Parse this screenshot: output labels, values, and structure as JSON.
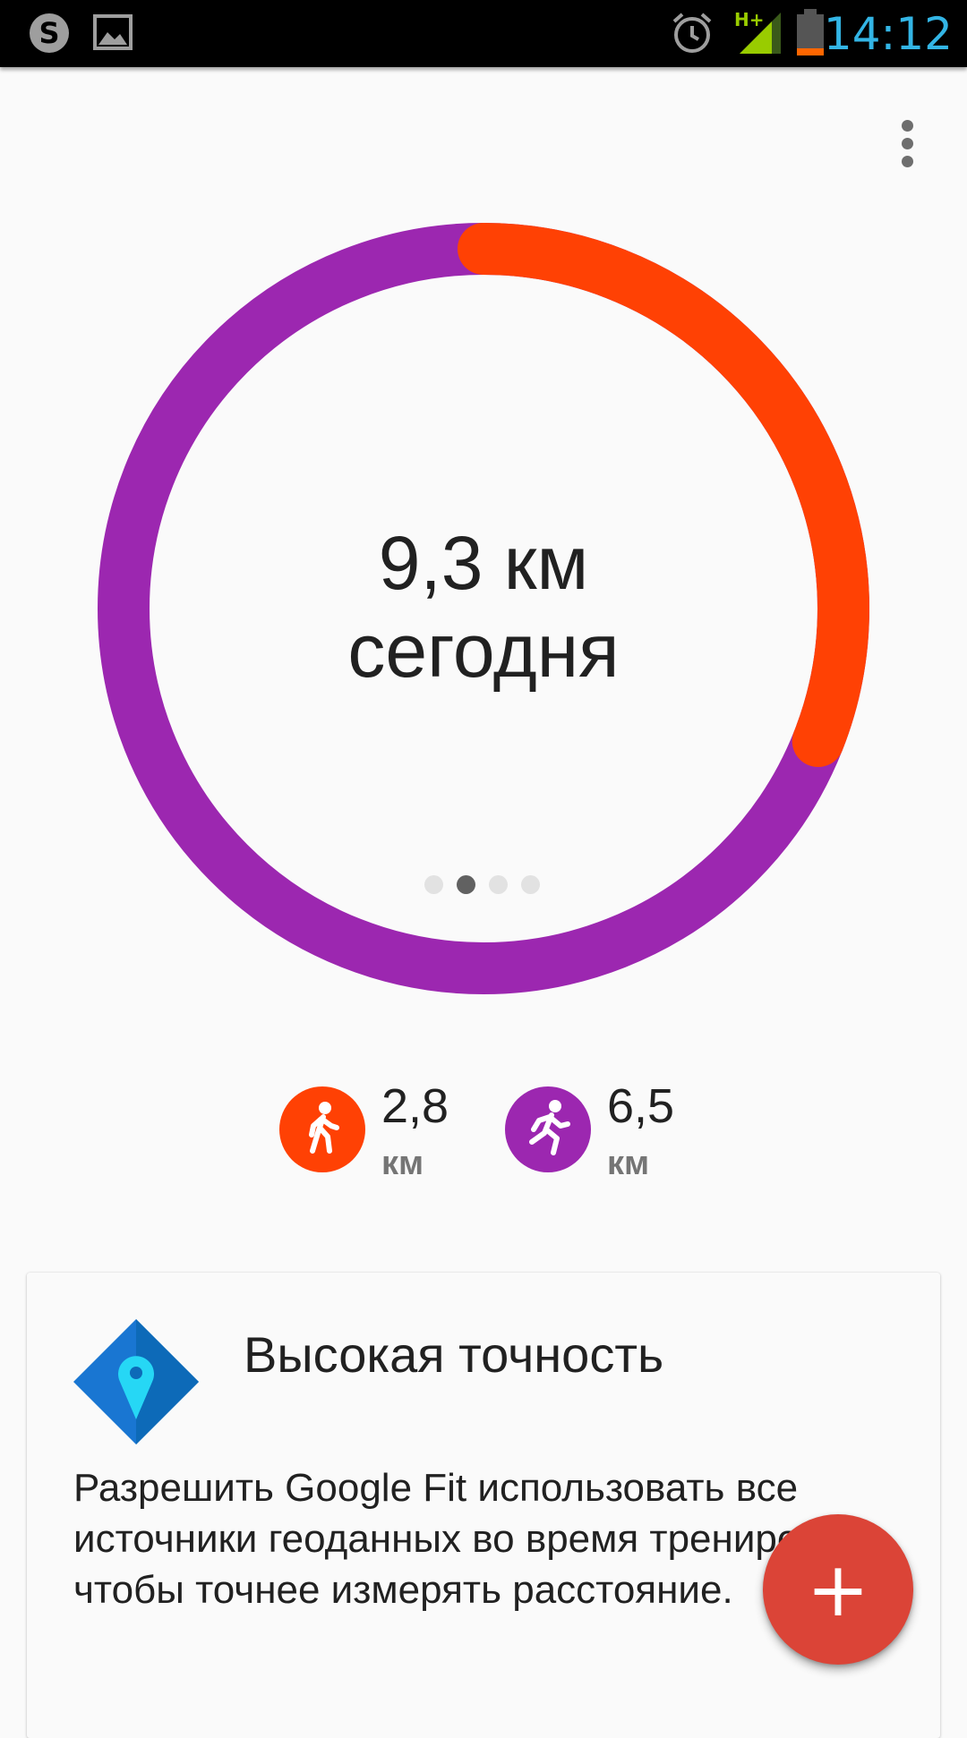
{
  "status_bar": {
    "time": "14:12",
    "network_label": "H+",
    "icons": [
      "skype-icon",
      "gallery-icon",
      "alarm-icon",
      "signal-icon",
      "battery-icon"
    ]
  },
  "summary": {
    "distance": "9,3 км",
    "period": "сегодня",
    "pager_count": 4,
    "pager_active_index": 1
  },
  "ring": {
    "walking_fraction": 0.31,
    "running_fraction": 0.69,
    "walking_color": "#ff4104",
    "running_color": "#9c27b0"
  },
  "activities": [
    {
      "name": "walking",
      "icon": "walking-icon",
      "value": "2,8",
      "unit": "км",
      "color": "#ff4104"
    },
    {
      "name": "running",
      "icon": "running-icon",
      "value": "6,5",
      "unit": "км",
      "color": "#9c27b0"
    }
  ],
  "card": {
    "icon": "location-pin-icon",
    "title": "Высокая точность",
    "body": "Разрешить Google Fit использовать все источники геоданных во время тренировок, чтобы точнее измерять расстояние."
  },
  "fab": {
    "label": "+",
    "color": "#db4437"
  }
}
